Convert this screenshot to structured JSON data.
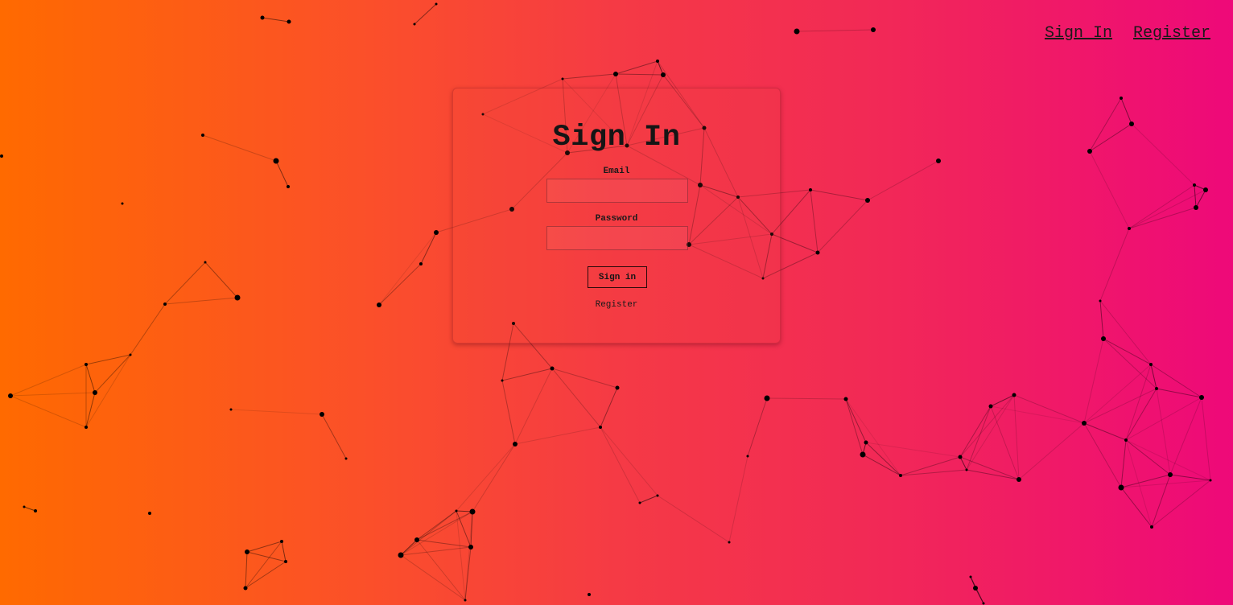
{
  "nav": {
    "sign_in": "Sign In",
    "register": "Register"
  },
  "form": {
    "title": "Sign In",
    "email_label": "Email",
    "email_value": "",
    "password_label": "Password",
    "password_value": "",
    "submit_label": "Sign in",
    "register_link": "Register"
  },
  "colors": {
    "gradient_start": "#ff6a00",
    "gradient_end": "#ee0979",
    "network_lines": "#000000"
  }
}
